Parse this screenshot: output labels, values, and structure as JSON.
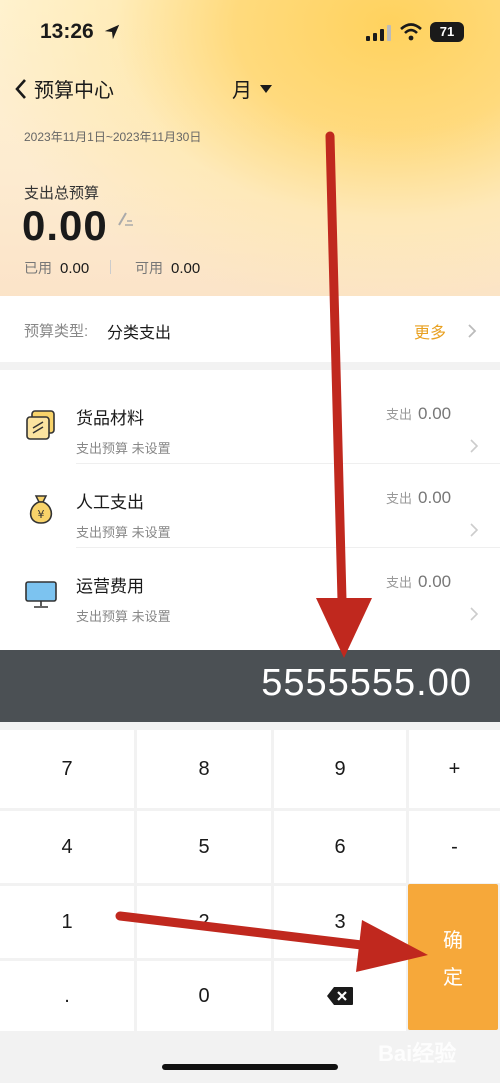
{
  "status_bar": {
    "time": "13:26",
    "battery": "71"
  },
  "nav": {
    "back_label": "预算中心",
    "period": "月"
  },
  "summary": {
    "date_range": "2023年11月1日~2023年11月30日",
    "budget_label": "支出总预算",
    "budget_value": "0.00",
    "used_label": "已用",
    "used_value": "0.00",
    "available_label": "可用",
    "available_value": "0.00"
  },
  "budget_type": {
    "label": "预算类型:",
    "value": "分类支出",
    "more": "更多"
  },
  "categories": [
    {
      "name": "货品材料",
      "subtitle": "支出预算 未设置",
      "expense_label": "支出",
      "expense_value": "0.00",
      "icon": "goods-icon"
    },
    {
      "name": "人工支出",
      "subtitle": "支出预算 未设置",
      "expense_label": "支出",
      "expense_value": "0.00",
      "icon": "money-bag-icon"
    },
    {
      "name": "运营费用",
      "subtitle": "支出预算 未设置",
      "expense_label": "支出",
      "expense_value": "0.00",
      "icon": "monitor-icon"
    }
  ],
  "input_display": "5555555.00",
  "keypad": {
    "keys": [
      "7",
      "8",
      "9",
      "+",
      "4",
      "5",
      "6",
      "-",
      "1",
      "2",
      "3",
      ".",
      "0"
    ],
    "confirm_label_1": "确",
    "confirm_label_2": "定",
    "backspace_icon": "backspace-icon"
  },
  "watermark": "Bai经验",
  "colors": {
    "accent": "#f6a83a",
    "more_text": "#e8a020",
    "display_bg": "#4b5054",
    "annotation_arrow": "#c0281e"
  }
}
